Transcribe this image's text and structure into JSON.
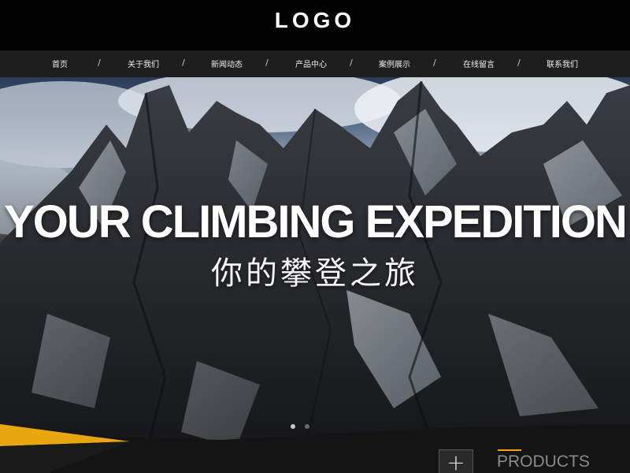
{
  "header": {
    "logo": "LOGO"
  },
  "nav": {
    "items": [
      "首页",
      "关于我们",
      "新闻动态",
      "产品中心",
      "案例展示",
      "在线留言",
      "联系我们"
    ],
    "separator": "/"
  },
  "hero": {
    "title": "YOUR CLIMBING EXPEDITION",
    "subtitle": "你的攀登之旅",
    "slides": {
      "count": 2,
      "active": 1
    }
  },
  "products": {
    "label": "PRODUCTS",
    "add_symbol": "+"
  },
  "colors": {
    "accent": "#f0a500",
    "nav_bg": "#1e1e1e",
    "header_bg": "#020202"
  }
}
